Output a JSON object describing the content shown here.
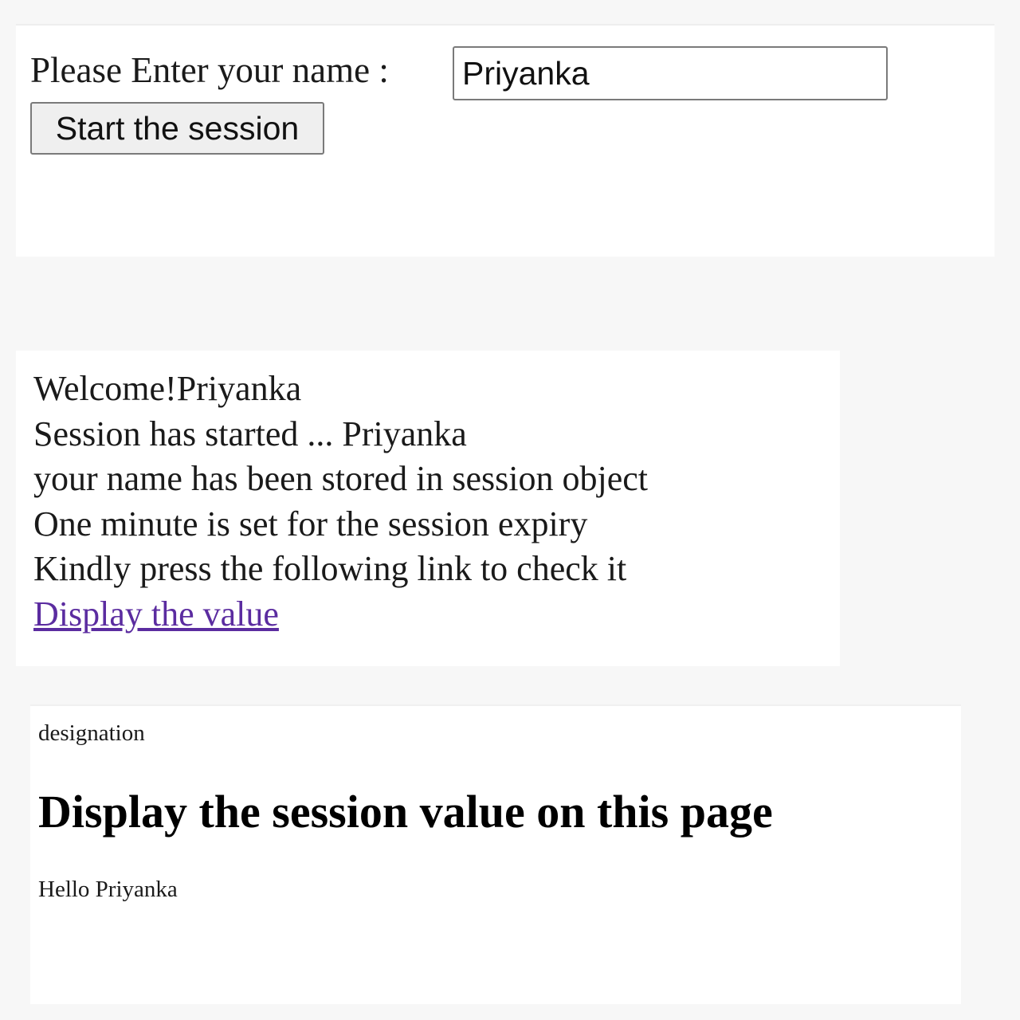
{
  "form": {
    "label": "Please Enter your name :",
    "name_value": "Priyanka",
    "start_button_label": "Start the session"
  },
  "welcome": {
    "lines": [
      "Welcome!Priyanka",
      "Session has started ... Priyanka",
      "your name has been stored in session object",
      "One minute is set for the session expiry",
      "Kindly press the following link to check it"
    ],
    "link_label": "Display the value",
    "link_color": "#5b2ca0"
  },
  "display": {
    "designation": "designation",
    "heading": "Display the session value on this page",
    "greeting": "Hello Priyanka"
  }
}
